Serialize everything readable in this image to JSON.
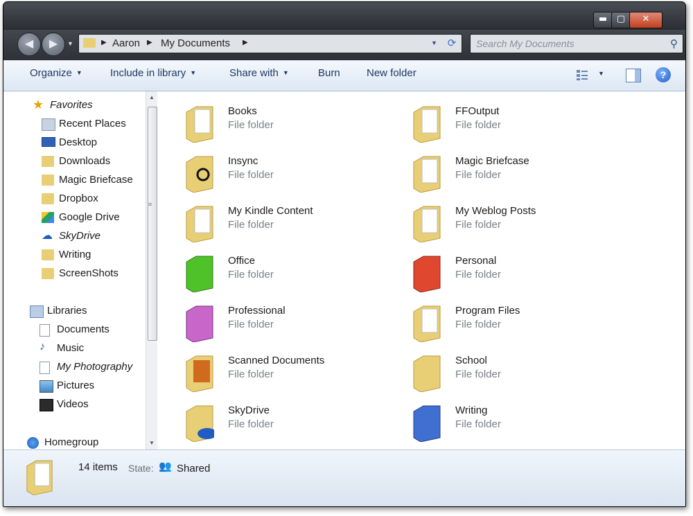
{
  "window": {
    "minimize_glyph": "▬",
    "maximize_glyph": "▢",
    "close_glyph": "✕"
  },
  "navigation": {
    "back_glyph": "◀",
    "forward_glyph": "▶",
    "breadcrumbs": [
      "Aaron",
      "My Documents"
    ],
    "search_placeholder": "Search My Documents"
  },
  "toolbar": {
    "organize": "Organize",
    "include_in_library": "Include in library",
    "share_with": "Share with",
    "burn": "Burn",
    "new_folder": "New folder",
    "help": "?"
  },
  "sidebar": {
    "favorites": {
      "label": "Favorites",
      "items": [
        "Recent Places",
        "Desktop",
        "Downloads",
        "Magic Briefcase",
        "Dropbox",
        "Google Drive",
        "SkyDrive",
        "Writing",
        "ScreenShots"
      ]
    },
    "libraries": {
      "label": "Libraries",
      "items": [
        "Documents",
        "Music",
        "My Photography",
        "Pictures",
        "Videos"
      ]
    },
    "homegroup": "Homegroup"
  },
  "files": [
    {
      "name": "Books",
      "type": "File folder",
      "color": "#e8cf76"
    },
    {
      "name": "FFOutput",
      "type": "File folder",
      "color": "#e8cf76"
    },
    {
      "name": "Insync",
      "type": "File folder",
      "color": "#e8cf76"
    },
    {
      "name": "Magic Briefcase",
      "type": "File folder",
      "color": "#e8cf76"
    },
    {
      "name": "My Kindle Content",
      "type": "File folder",
      "color": "#e8cf76"
    },
    {
      "name": "My Weblog Posts",
      "type": "File folder",
      "color": "#e8cf76"
    },
    {
      "name": "Office",
      "type": "File folder",
      "color": "#4fc22a"
    },
    {
      "name": "Personal",
      "type": "File folder",
      "color": "#e0472f"
    },
    {
      "name": "Professional",
      "type": "File folder",
      "color": "#c867c9"
    },
    {
      "name": "Program Files",
      "type": "File folder",
      "color": "#e8cf76"
    },
    {
      "name": "Scanned Documents",
      "type": "File folder",
      "color": "#e8cf76"
    },
    {
      "name": "School",
      "type": "File folder",
      "color": "#e8cf76"
    },
    {
      "name": "SkyDrive",
      "type": "File folder",
      "color": "#e8cf76"
    },
    {
      "name": "Writing",
      "type": "File folder",
      "color": "#3f6fd1"
    }
  ],
  "status": {
    "count": "14 items",
    "state_label": "State:",
    "state_value": "Shared"
  }
}
